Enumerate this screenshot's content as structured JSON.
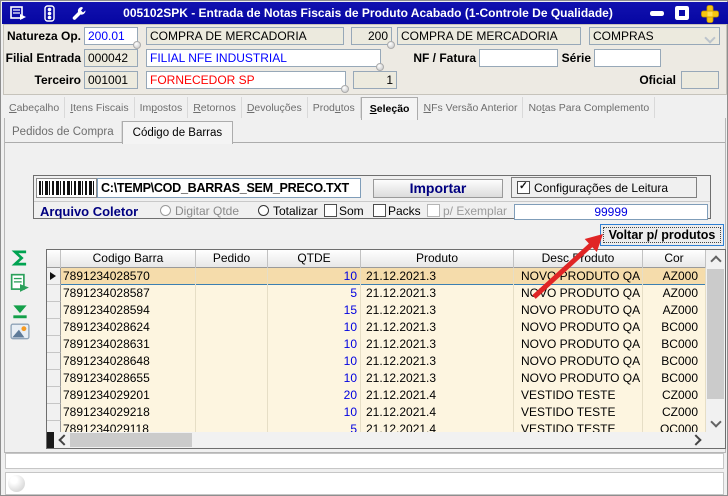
{
  "window": {
    "title": "005102SPK - Entrada de Notas Fiscais de Produto Acabado (1-Controle De Qualidade)"
  },
  "titlebar_icons": [
    "form-icon",
    "traffic-light-icon",
    "wrench-icon",
    "minimize-icon",
    "maximize-icon",
    "close-plus-icon"
  ],
  "form": {
    "natureza_label": "Natureza Op.",
    "natureza_code": "200.01",
    "natureza_desc": "COMPRA DE MERCADORIA",
    "natureza_num": "200",
    "natureza_desc2": "COMPRA DE MERCADORIA",
    "tipo_combo": "COMPRAS",
    "filial_label": "Filial Entrada",
    "filial_code": "000042",
    "filial_desc": "FILIAL NFE INDUSTRIAL",
    "nf_label": "NF / Fatura",
    "nf_value": "",
    "serie_label": "Série",
    "serie_value": "",
    "terceiro_label": "Terceiro",
    "terceiro_code": "001001",
    "terceiro_desc": "FORNECEDOR SP",
    "terceiro_num": "1",
    "oficial_label": "Oficial",
    "oficial_value": ""
  },
  "tabs_main": {
    "items": [
      {
        "label": "Cabeçalho",
        "accel": 0,
        "active": false
      },
      {
        "label": "Itens Fiscais",
        "accel": 0,
        "active": false
      },
      {
        "label": "Impostos",
        "accel": 2,
        "active": false
      },
      {
        "label": "Retornos",
        "accel": 0,
        "active": false
      },
      {
        "label": "Devoluções",
        "accel": 0,
        "active": false
      },
      {
        "label": "Produtos",
        "accel": 4,
        "active": false
      },
      {
        "label": "Seleção",
        "accel": 0,
        "active": true
      },
      {
        "label": "NFs Versão Anterior",
        "accel": 0,
        "active": false
      },
      {
        "label": "Notas Para Complemento",
        "accel": 2,
        "active": false
      }
    ]
  },
  "tabs_sub": {
    "items": [
      {
        "label": "Pedidos de Compra",
        "active": false
      },
      {
        "label": "Código de Barras",
        "active": true
      }
    ]
  },
  "import": {
    "barcode_icon": "barcode-icon",
    "file_path": "C:\\TEMP\\COD_BARRAS_SEM_PRECO.TXT",
    "import_button": "Importar",
    "config_checkbox_label": "Configurações de Leitura",
    "config_checked": true,
    "arquivo_label": "Arquivo Coletor",
    "radio_digitar": "Digitar Qtde",
    "radio_totalizar": "Totalizar",
    "chk_som": "Som",
    "chk_packs": "Packs",
    "chk_exemplar": "p/ Exemplar",
    "limit_value": "99999",
    "voltar_button": "Voltar p/ produtos"
  },
  "toolbar_icons": [
    "sum-sigma-icon",
    "export-grid-icon",
    "append-bottom-icon",
    "image-icon"
  ],
  "grid": {
    "columns": [
      "Codigo Barra",
      "Pedido",
      "QTDE",
      "Produto",
      "Desc Produto",
      "Cor"
    ],
    "selected_row": 0,
    "rows": [
      {
        "barcode": "7891234028570",
        "pedido": "",
        "qtde": "10",
        "produto": "21.12.2021.3",
        "desc": "NOVO PRODUTO QA",
        "cor": "AZ000"
      },
      {
        "barcode": "7891234028587",
        "pedido": "",
        "qtde": "5",
        "produto": "21.12.2021.3",
        "desc": "NOVO PRODUTO QA",
        "cor": "AZ000"
      },
      {
        "barcode": "7891234028594",
        "pedido": "",
        "qtde": "15",
        "produto": "21.12.2021.3",
        "desc": "NOVO PRODUTO QA",
        "cor": "AZ000"
      },
      {
        "barcode": "7891234028624",
        "pedido": "",
        "qtde": "10",
        "produto": "21.12.2021.3",
        "desc": "NOVO PRODUTO QA",
        "cor": "BC000"
      },
      {
        "barcode": "7891234028631",
        "pedido": "",
        "qtde": "10",
        "produto": "21.12.2021.3",
        "desc": "NOVO PRODUTO QA",
        "cor": "BC000"
      },
      {
        "barcode": "7891234028648",
        "pedido": "",
        "qtde": "10",
        "produto": "21.12.2021.3",
        "desc": "NOVO PRODUTO QA",
        "cor": "BC000"
      },
      {
        "barcode": "7891234028655",
        "pedido": "",
        "qtde": "10",
        "produto": "21.12.2021.3",
        "desc": "NOVO PRODUTO QA",
        "cor": "BC000"
      },
      {
        "barcode": "7891234029201",
        "pedido": "",
        "qtde": "20",
        "produto": "21.12.2021.4",
        "desc": "VESTIDO TESTE",
        "cor": "CZ000"
      },
      {
        "barcode": "7891234029218",
        "pedido": "",
        "qtde": "10",
        "produto": "21.12.2021.4",
        "desc": "VESTIDO TESTE",
        "cor": "CZ000"
      },
      {
        "barcode": "7891234029118",
        "pedido": "",
        "qtde": "5",
        "produto": "21.12.2021.4",
        "desc": "VESTIDO TESTE",
        "cor": "OC000"
      }
    ]
  },
  "colors": {
    "titlebar": "#0a0aab",
    "navy": "#000080",
    "value_blue": "#0000ff",
    "value_red": "#ff0000",
    "qtde_blue": "#0000e0",
    "row_bg": "#fdf5e0",
    "row_selected": "#f5dcab",
    "arrow_red": "#e02525"
  }
}
